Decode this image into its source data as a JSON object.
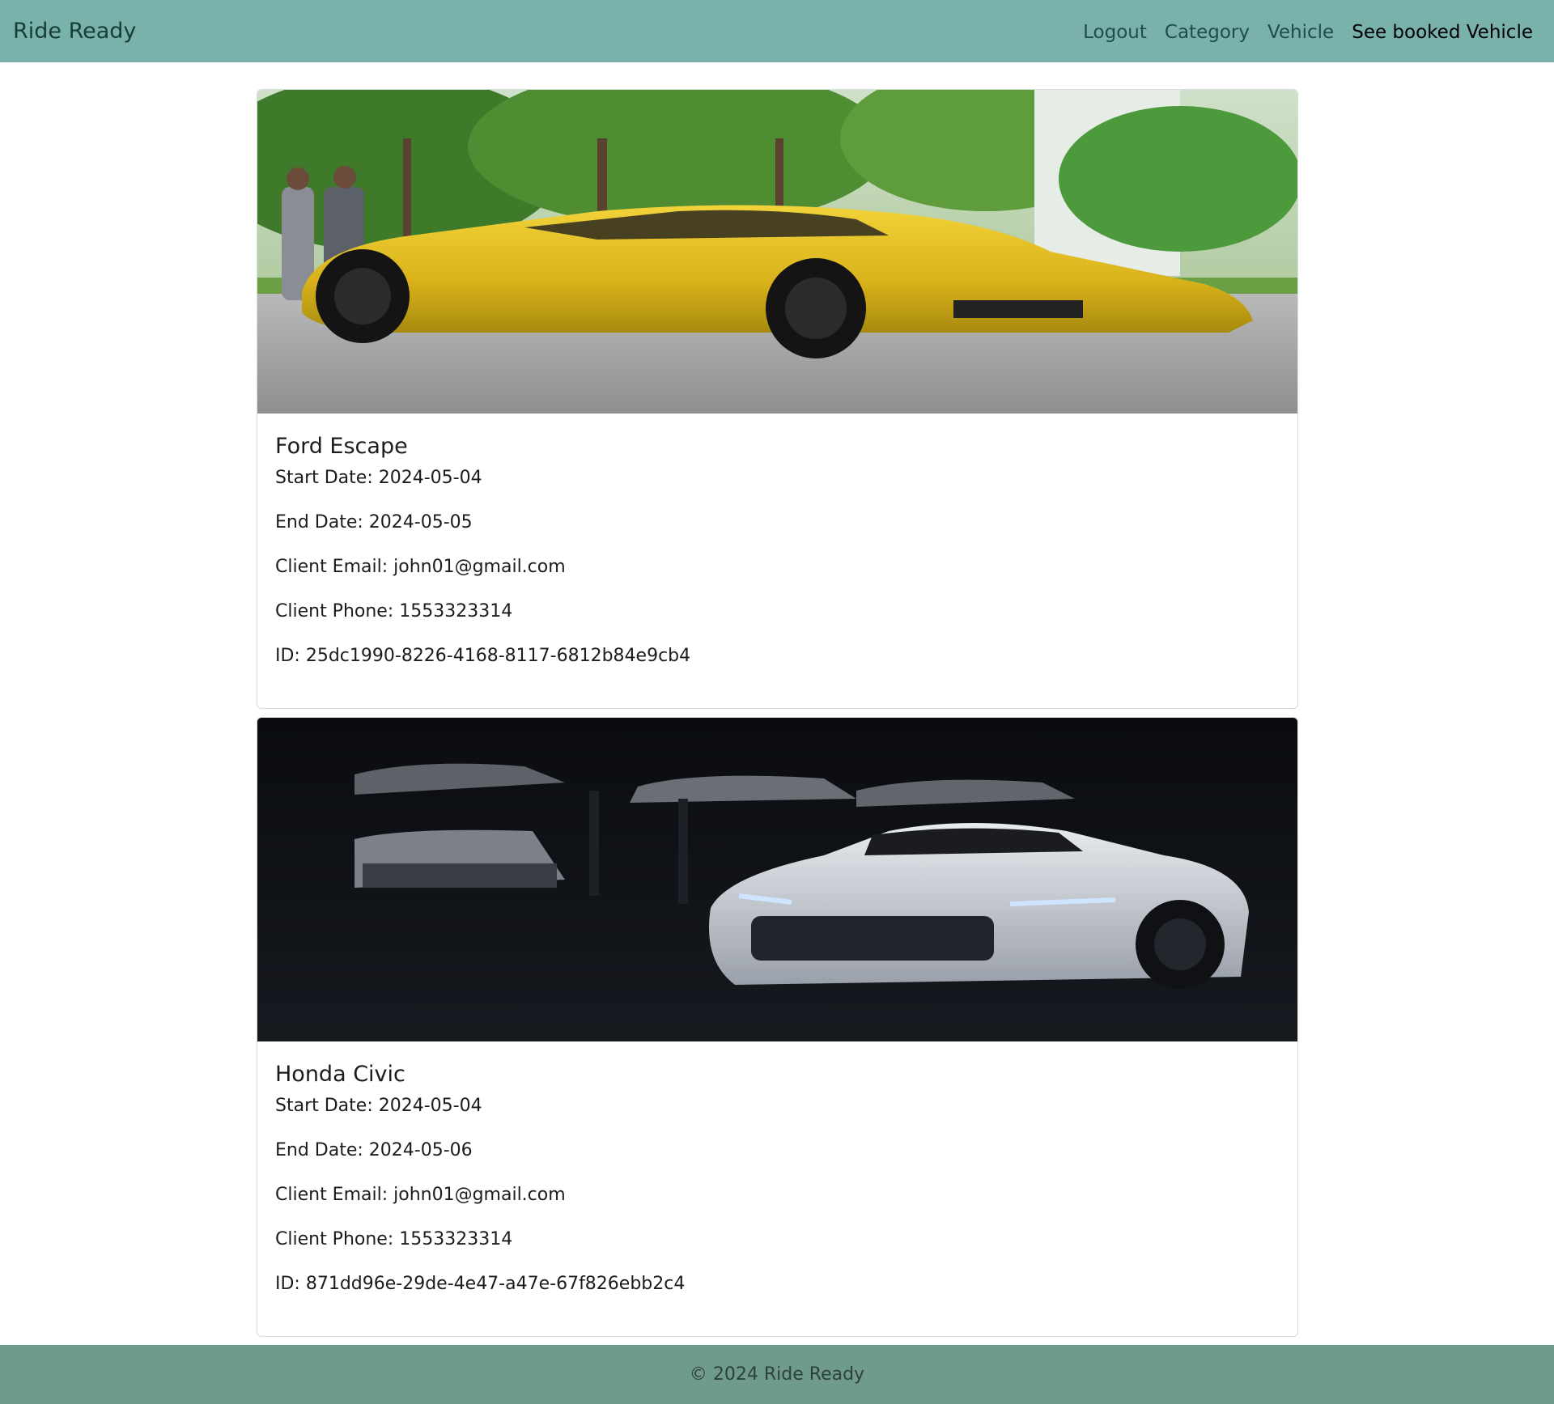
{
  "navbar": {
    "brand": "Ride Ready",
    "links": [
      {
        "label": "Logout"
      },
      {
        "label": "Category"
      },
      {
        "label": "Vehicle"
      },
      {
        "label": "See booked Vehicle"
      }
    ]
  },
  "bookings": [
    {
      "title": "Ford Escape",
      "start_date": "Start Date: 2024-05-04",
      "end_date": "End Date: 2024-05-05",
      "client_email": "Client Email: john01@gmail.com",
      "client_phone": "Client Phone: 1553323314",
      "id": "ID: 25dc1990-8226-4168-8117-6812b84e9cb4",
      "image": "yellow sports car parked on a tree-lined street"
    },
    {
      "title": "Honda Civic",
      "start_date": "Start Date: 2024-05-04",
      "end_date": "End Date: 2024-05-06",
      "client_email": "Client Email: john01@gmail.com",
      "client_phone": "Client Phone: 1553323314",
      "id": "ID: 871dd96e-29de-4e47-a47e-67f826ebb2c4",
      "image": "white sports car in a dark garage"
    }
  ],
  "footer": {
    "text": "© 2024 Ride Ready"
  },
  "colors": {
    "navbar_bg": "#79b1ab",
    "footer_bg": "#6f9b8c",
    "brand_text": "#173d3a",
    "active_link": "#000000"
  }
}
